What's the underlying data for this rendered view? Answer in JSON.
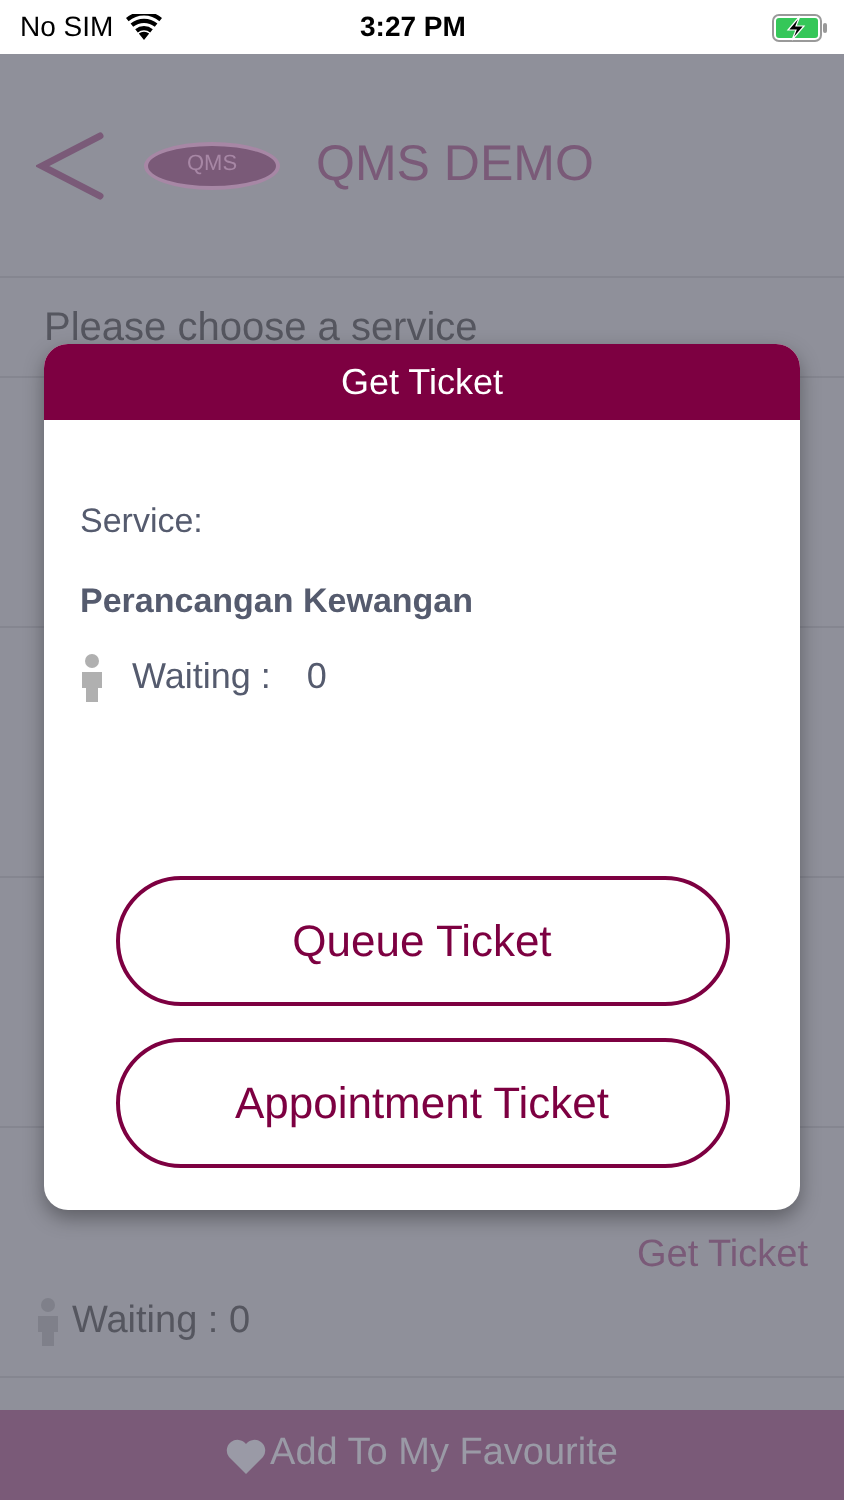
{
  "status_bar": {
    "carrier": "No SIM",
    "time": "3:27 PM",
    "battery_charging": true
  },
  "header": {
    "title": "QMS DEMO",
    "logo_text": "QMS"
  },
  "service_prompt": "Please choose a service",
  "services": [
    {
      "action": "Get Ticket",
      "waiting": "Waiting : 0"
    }
  ],
  "favourite_button": "Add To My Favourite",
  "dialog": {
    "title": "Get Ticket",
    "service_label": "Service:",
    "service_name": "Perancangan Kewangan",
    "waiting_label": "Waiting :",
    "waiting_count": "0",
    "buttons": [
      "Queue Ticket",
      "Appointment Ticket"
    ]
  }
}
